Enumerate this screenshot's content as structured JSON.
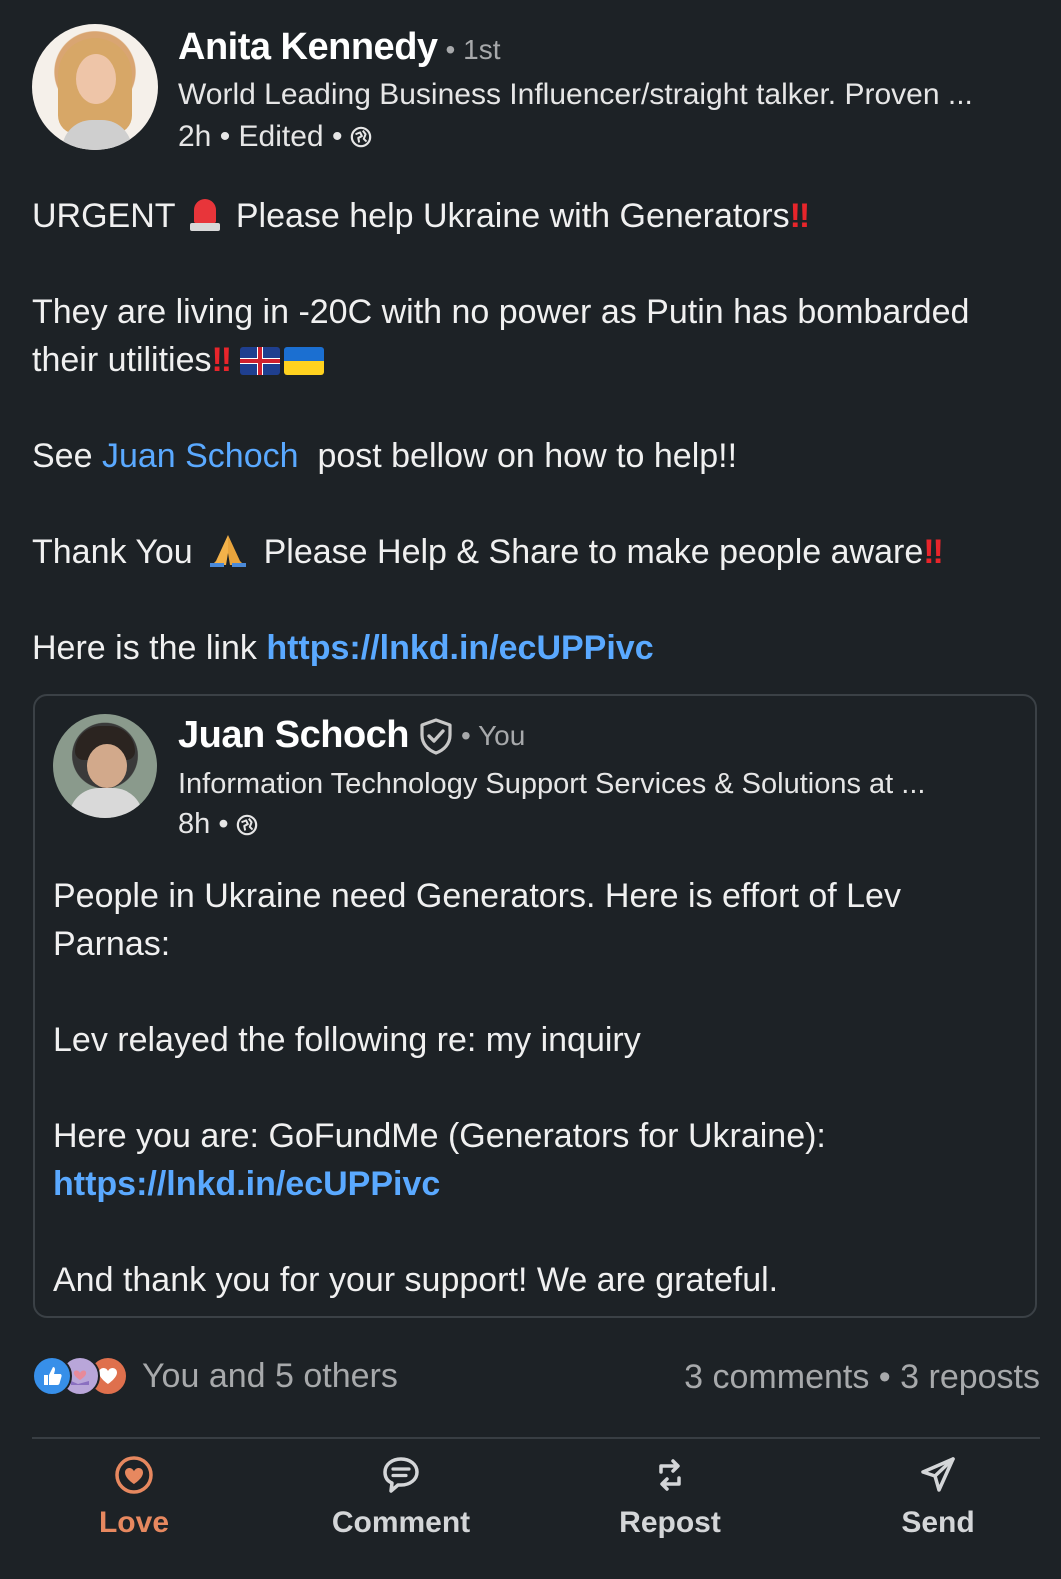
{
  "author": {
    "name": "Anita Kennedy",
    "degree": "• 1st",
    "headline": "World Leading Business Influencer/straight talker. Proven ...",
    "time": "2h • Edited •"
  },
  "body": {
    "line1_a": "URGENT",
    "line1_b": "Please help Ukraine with Generators",
    "line2_a": "They are living in -20C with no power as Putin has bombarded their utilities",
    "line3_a": "See ",
    "line3_mention": "Juan Schoch",
    "line3_b": "  post bellow on how to help!!",
    "line4_a": "Thank You",
    "line4_b": "Please Help & Share to make people aware",
    "line5_a": "Here is the link ",
    "line5_link": "https://lnkd.in/ecUPPivc",
    "bang": "‼"
  },
  "shared": {
    "name": "Juan Schoch",
    "you": "• You",
    "headline": "Information Technology Support Services & Solutions at ...",
    "time": "8h •",
    "p1": "People in Ukraine need Generators. Here is effort of Lev Parnas:",
    "p2": "Lev relayed the following re: my inquiry",
    "p3": "Here you are: GoFundMe (Generators for Ukraine):",
    "p3_link": "https://lnkd.in/ecUPPivc",
    "p4": "And thank you for your support! We are grateful."
  },
  "social": {
    "reactions_text": "You and 5 others",
    "counts_text": "3 comments • 3 reposts",
    "reaction_icons": [
      "like-icon",
      "support-icon",
      "love-icon"
    ]
  },
  "actions": {
    "love": "Love",
    "comment": "Comment",
    "repost": "Repost",
    "send": "Send"
  },
  "colors": {
    "background": "#1d2226",
    "link": "#5aa9ff",
    "active_action": "#e7885f",
    "muted_text": "#a7a9ab"
  }
}
